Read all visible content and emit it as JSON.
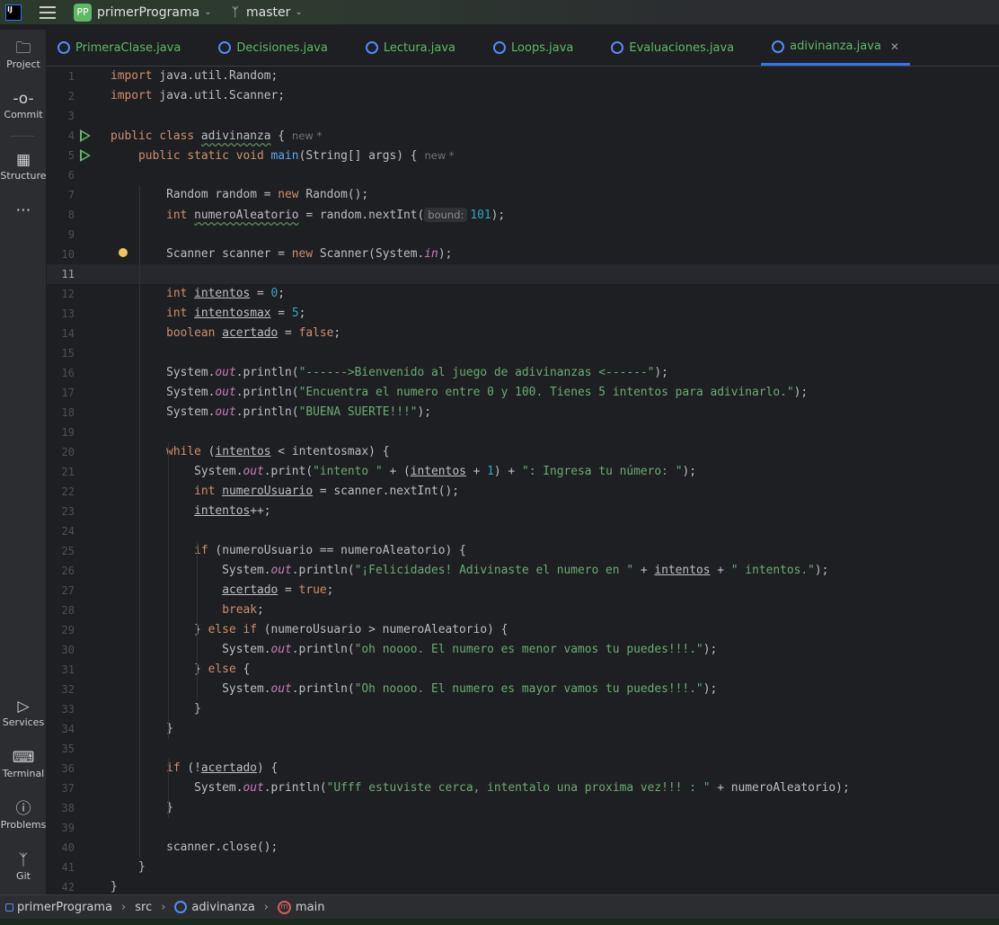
{
  "titlebar": {
    "logo": "IJ",
    "project_badge": "PP",
    "project": "primerPrograma",
    "branch": "master"
  },
  "sidebar": {
    "top": [
      {
        "label": "Project",
        "icon": "folder-icon"
      },
      {
        "label": "Commit",
        "icon": "commit-icon"
      },
      {
        "label": "Structure",
        "icon": "structure-icon"
      },
      {
        "label": "",
        "icon": "more-icon"
      }
    ],
    "bottom": [
      {
        "label": "Services",
        "icon": "services-icon"
      },
      {
        "label": "Terminal",
        "icon": "terminal-icon"
      },
      {
        "label": "Problems",
        "icon": "problems-icon"
      },
      {
        "label": "Git",
        "icon": "git-icon"
      }
    ]
  },
  "tabs": [
    {
      "label": "PrimeraClase.java"
    },
    {
      "label": "Decisiones.java"
    },
    {
      "label": "Lectura.java"
    },
    {
      "label": "Loops.java"
    },
    {
      "label": "Evaluaciones.java"
    },
    {
      "label": "adivinanza.java",
      "active": true
    }
  ],
  "editor": {
    "current_line": 11,
    "lines": [
      {
        "n": 1,
        "t": [
          [
            "k",
            "import"
          ],
          [
            "",
            " java.util.Random;"
          ]
        ]
      },
      {
        "n": 2,
        "t": [
          [
            "k",
            "import"
          ],
          [
            "",
            " java.util.Scanner;"
          ]
        ]
      },
      {
        "n": 3,
        "t": []
      },
      {
        "n": 4,
        "run": true,
        "t": [
          [
            "k",
            "public class "
          ],
          [
            "w",
            "adivinanza"
          ],
          [
            "",
            " {"
          ],
          [
            "h",
            "new *"
          ]
        ]
      },
      {
        "n": 5,
        "run": true,
        "t": [
          [
            "",
            "    "
          ],
          [
            "k",
            "public static void "
          ],
          [
            "fn",
            "main"
          ],
          [
            "",
            "(String[] args) {"
          ],
          [
            "h",
            "new *"
          ]
        ]
      },
      {
        "n": 6,
        "t": []
      },
      {
        "n": 7,
        "t": [
          [
            "",
            "        Random random = "
          ],
          [
            "k",
            "new"
          ],
          [
            "",
            " Random();"
          ]
        ]
      },
      {
        "n": 8,
        "t": [
          [
            "",
            "        "
          ],
          [
            "k",
            "int "
          ],
          [
            "w",
            "numeroAleatorio"
          ],
          [
            "",
            " = random.nextInt("
          ],
          [
            "hb",
            "bound:"
          ],
          [
            "n",
            "101"
          ],
          [
            "",
            ");"
          ]
        ]
      },
      {
        "n": 9,
        "t": []
      },
      {
        "n": 10,
        "bulb": true,
        "t": [
          [
            "",
            "        Scanner scanner = "
          ],
          [
            "k",
            "new"
          ],
          [
            "",
            " Scanner(System."
          ],
          [
            "f",
            "in"
          ],
          [
            "",
            ");"
          ]
        ]
      },
      {
        "n": 11,
        "t": []
      },
      {
        "n": 12,
        "t": [
          [
            "",
            "        "
          ],
          [
            "k",
            "int "
          ],
          [
            "u",
            "intentos"
          ],
          [
            "",
            " = "
          ],
          [
            "n",
            "0"
          ],
          [
            "",
            ";"
          ]
        ]
      },
      {
        "n": 13,
        "t": [
          [
            "",
            "        "
          ],
          [
            "k",
            "int "
          ],
          [
            "u",
            "intentosmax"
          ],
          [
            "",
            " = "
          ],
          [
            "n",
            "5"
          ],
          [
            "",
            ";"
          ]
        ]
      },
      {
        "n": 14,
        "t": [
          [
            "",
            "        "
          ],
          [
            "k",
            "boolean "
          ],
          [
            "u",
            "acertado"
          ],
          [
            "",
            " = "
          ],
          [
            "k",
            "false"
          ],
          [
            "",
            ";"
          ]
        ]
      },
      {
        "n": 15,
        "t": []
      },
      {
        "n": 16,
        "t": [
          [
            "",
            "        System."
          ],
          [
            "f",
            "out"
          ],
          [
            "",
            ".println("
          ],
          [
            "s",
            "\"------>Bienvenido al juego de adivinanzas <------\""
          ],
          [
            "",
            ");"
          ]
        ]
      },
      {
        "n": 17,
        "t": [
          [
            "",
            "        System."
          ],
          [
            "f",
            "out"
          ],
          [
            "",
            ".println("
          ],
          [
            "s",
            "\"Encuentra el numero entre 0 y 100. Tienes 5 intentos para adivinarlo.\""
          ],
          [
            "",
            ");"
          ]
        ]
      },
      {
        "n": 18,
        "t": [
          [
            "",
            "        System."
          ],
          [
            "f",
            "out"
          ],
          [
            "",
            ".println("
          ],
          [
            "s",
            "\"BUENA SUERTE!!!\""
          ],
          [
            "",
            ");"
          ]
        ]
      },
      {
        "n": 19,
        "t": []
      },
      {
        "n": 20,
        "t": [
          [
            "",
            "        "
          ],
          [
            "k",
            "while"
          ],
          [
            "",
            " ("
          ],
          [
            "u",
            "intentos"
          ],
          [
            "",
            " < intentosmax) {"
          ]
        ]
      },
      {
        "n": 21,
        "t": [
          [
            "",
            "            System."
          ],
          [
            "f",
            "out"
          ],
          [
            "",
            ".print("
          ],
          [
            "s",
            "\"intento \""
          ],
          [
            "",
            " + ("
          ],
          [
            "u",
            "intentos"
          ],
          [
            "",
            " + "
          ],
          [
            "n",
            "1"
          ],
          [
            "",
            ") + "
          ],
          [
            "s",
            "\": Ingresa tu número: \""
          ],
          [
            "",
            ");"
          ]
        ]
      },
      {
        "n": 22,
        "t": [
          [
            "",
            "            "
          ],
          [
            "k",
            "int "
          ],
          [
            "u",
            "numeroUsuario"
          ],
          [
            "",
            " = scanner.nextInt();"
          ]
        ]
      },
      {
        "n": 23,
        "t": [
          [
            "",
            "            "
          ],
          [
            "u",
            "intentos"
          ],
          [
            "",
            "++;"
          ]
        ]
      },
      {
        "n": 24,
        "t": []
      },
      {
        "n": 25,
        "t": [
          [
            "",
            "            "
          ],
          [
            "k",
            "if"
          ],
          [
            "",
            " (numeroUsuario == numeroAleatorio) {"
          ]
        ]
      },
      {
        "n": 26,
        "t": [
          [
            "",
            "                System."
          ],
          [
            "f",
            "out"
          ],
          [
            "",
            ".println("
          ],
          [
            "s",
            "\"¡Felicidades! Adivinaste el numero en \""
          ],
          [
            "",
            " + "
          ],
          [
            "u",
            "intentos"
          ],
          [
            "",
            " + "
          ],
          [
            "s",
            "\" intentos.\""
          ],
          [
            "",
            ");"
          ]
        ]
      },
      {
        "n": 27,
        "t": [
          [
            "",
            "                "
          ],
          [
            "u",
            "acertado"
          ],
          [
            "",
            " = "
          ],
          [
            "k",
            "true"
          ],
          [
            "",
            ";"
          ]
        ]
      },
      {
        "n": 28,
        "t": [
          [
            "",
            "                "
          ],
          [
            "k",
            "break"
          ],
          [
            "",
            ";"
          ]
        ]
      },
      {
        "n": 29,
        "t": [
          [
            "",
            "            } "
          ],
          [
            "k",
            "else if"
          ],
          [
            "",
            " (numeroUsuario > numeroAleatorio) {"
          ]
        ]
      },
      {
        "n": 30,
        "t": [
          [
            "",
            "                System."
          ],
          [
            "f",
            "out"
          ],
          [
            "",
            ".println("
          ],
          [
            "s",
            "\"oh noooo. El numero es menor vamos tu puedes!!!.\""
          ],
          [
            "",
            ");"
          ]
        ]
      },
      {
        "n": 31,
        "t": [
          [
            "",
            "            } "
          ],
          [
            "k",
            "else"
          ],
          [
            "",
            " {"
          ]
        ]
      },
      {
        "n": 32,
        "t": [
          [
            "",
            "                System."
          ],
          [
            "f",
            "out"
          ],
          [
            "",
            ".println("
          ],
          [
            "s",
            "\"Oh noooo. El numero es mayor vamos tu puedes!!!.\""
          ],
          [
            "",
            ");"
          ]
        ]
      },
      {
        "n": 33,
        "t": [
          [
            "",
            "            }"
          ]
        ]
      },
      {
        "n": 34,
        "t": [
          [
            "",
            "        }"
          ]
        ]
      },
      {
        "n": 35,
        "t": []
      },
      {
        "n": 36,
        "t": [
          [
            "",
            "        "
          ],
          [
            "k",
            "if"
          ],
          [
            "",
            " (!"
          ],
          [
            "u",
            "acertado"
          ],
          [
            "",
            ") {"
          ]
        ]
      },
      {
        "n": 37,
        "t": [
          [
            "",
            "            System."
          ],
          [
            "f",
            "out"
          ],
          [
            "",
            ".println("
          ],
          [
            "s",
            "\"Ufff estuviste cerca, intentalo una proxima vez!!! : \""
          ],
          [
            "",
            " + numeroAleatorio);"
          ]
        ]
      },
      {
        "n": 38,
        "t": [
          [
            "",
            "        }"
          ]
        ]
      },
      {
        "n": 39,
        "t": []
      },
      {
        "n": 40,
        "t": [
          [
            "",
            "        scanner.close();"
          ]
        ]
      },
      {
        "n": 41,
        "t": [
          [
            "",
            "    }"
          ]
        ]
      },
      {
        "n": 42,
        "t": [
          [
            "",
            "}"
          ]
        ]
      }
    ]
  },
  "breadcrumb": [
    "primerPrograma",
    "src",
    "adivinanza",
    "main"
  ]
}
